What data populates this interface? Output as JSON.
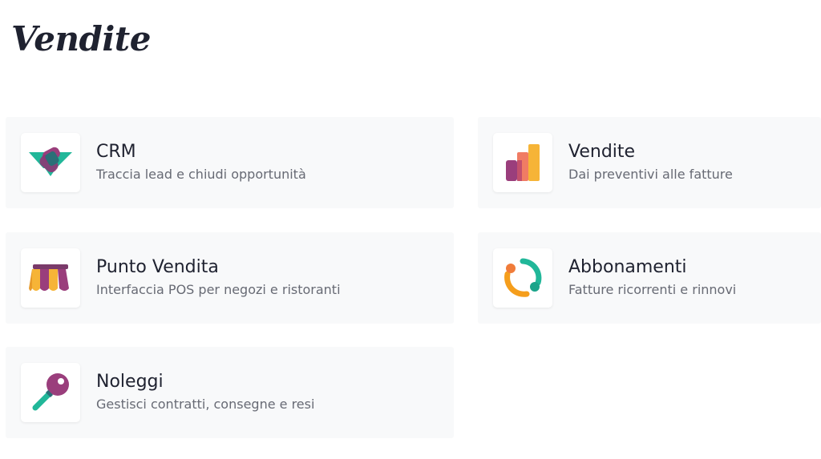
{
  "section": {
    "title": "Vendite"
  },
  "apps": [
    {
      "title": "CRM",
      "description": "Traccia lead e chiudi opportunità",
      "icon": "handshake-icon"
    },
    {
      "title": "Vendite",
      "description": "Dai preventivi alle fatture",
      "icon": "bar-chart-icon"
    },
    {
      "title": "Punto Vendita",
      "description": "Interfaccia POS per negozi e ristoranti",
      "icon": "shop-awning-icon"
    },
    {
      "title": "Abbonamenti",
      "description": "Fatture ricorrenti e rinnovi",
      "icon": "recurring-cycle-icon"
    },
    {
      "title": "Noleggi",
      "description": "Gestisci contratti, consegne e resi",
      "icon": "key-icon"
    }
  ],
  "colors": {
    "card_background": "#f8f9fa",
    "title_text": "#1f2230",
    "description_text": "#676a74",
    "icon_teal": "#21b799",
    "icon_purple": "#9a3e7c",
    "icon_orange": "#f59e1c",
    "icon_pink": "#f07c64"
  }
}
